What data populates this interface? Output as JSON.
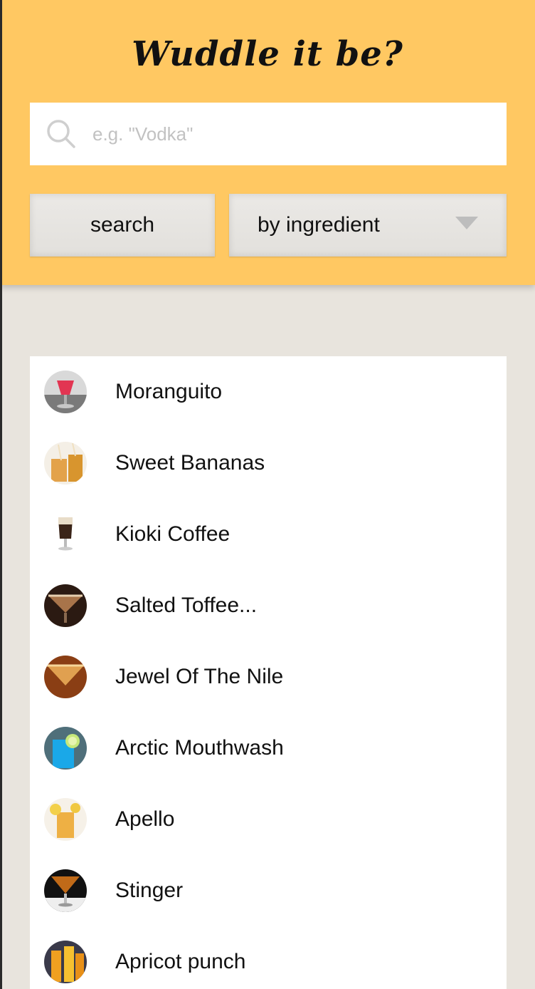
{
  "header": {
    "title": "Wuddle it be?",
    "background": "#ffc862"
  },
  "search": {
    "placeholder": "e.g. \"Vodka\"",
    "value": "",
    "icon": "search-icon",
    "button_label": "search"
  },
  "filter": {
    "selected": "by ingredient",
    "icon": "caret-down-icon"
  },
  "results": [
    {
      "name": "Moranguito",
      "thumb": "cocktail-photo"
    },
    {
      "name": "Sweet Bananas",
      "thumb": "cocktail-photo"
    },
    {
      "name": "Kioki Coffee",
      "thumb": "cocktail-photo"
    },
    {
      "name": "Salted Toffee...",
      "thumb": "cocktail-photo"
    },
    {
      "name": "Jewel Of The Nile",
      "thumb": "cocktail-photo"
    },
    {
      "name": "Arctic Mouthwash",
      "thumb": "cocktail-photo"
    },
    {
      "name": "Apello",
      "thumb": "cocktail-photo"
    },
    {
      "name": "Stinger",
      "thumb": "cocktail-photo"
    },
    {
      "name": "Apricot punch",
      "thumb": "cocktail-photo"
    }
  ]
}
